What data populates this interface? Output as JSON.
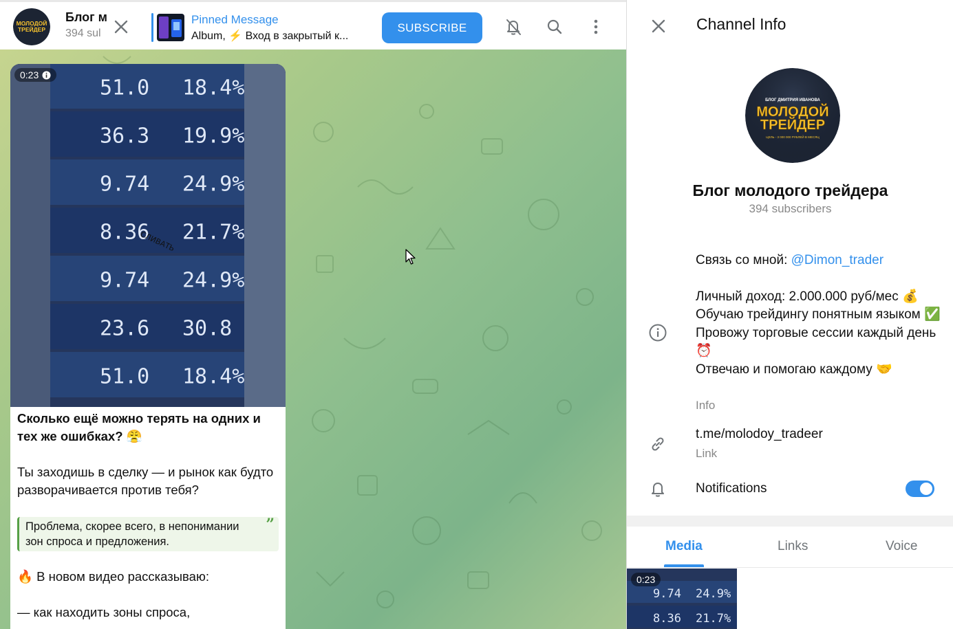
{
  "chat": {
    "header": {
      "title": "Блог м",
      "subscribers": "394 sul",
      "pinned_title": "Pinned Message",
      "pinned_body": "Album, ⚡ Вход в закрытый к...",
      "subscribe_label": "SUBSCRIBE"
    },
    "message": {
      "video_duration": "0:23",
      "video_rows": [
        {
          "left": "51.0",
          "right": "18.4%"
        },
        {
          "left": "36.3",
          "right": "19.9%"
        },
        {
          "left": "9.74",
          "right": "24.9%"
        },
        {
          "left": "8.36",
          "right": "21.7%"
        },
        {
          "left": "9.74",
          "right": "24.9%"
        },
        {
          "left": "23.6",
          "right": "30.8"
        },
        {
          "left": "51.0",
          "right": "18.4%"
        }
      ],
      "video_overlay_word": "СЛИВАТЬ",
      "heading": "Сколько ещё можно терять на одних и тех же ошибках? 😤",
      "paragraph1": "Ты заходишь в сделку — и рынок как будто разворачивается против тебя?",
      "quote": "Проблема, скорее всего, в непонимании зон спроса и предложения.",
      "paragraph2": "🔥 В новом видео рассказываю:",
      "paragraph3": "— как находить зоны спроса,"
    }
  },
  "panel": {
    "title": "Channel Info",
    "avatar": {
      "top_line": "БЛОГ ДМИТРИЯ ИВАНОВА",
      "word1": "МОЛОДОЙ",
      "word2": "ТРЕЙДЕР",
      "bottom_line": "ЦЕЛЬ - 3 000 000 РУБЛЕЙ В МЕСЯЦ"
    },
    "channel_name": "Блог молодого трейдера",
    "subscribers": "394 subscribers",
    "info": {
      "contact_prefix": "Связь со мной: ",
      "contact_handle": "@Dimon_trader",
      "line1": "Личный доход: 2.000.000 руб/мес 💰",
      "line2": "Обучаю трейдингу понятным языком ✅",
      "line3": "Провожу торговые сессии каждый день ⏰",
      "line4": "Отвечаю и помогаю каждому 🤝",
      "label": "Info"
    },
    "link": {
      "value": "t.me/molodoy_tradeer",
      "label": "Link"
    },
    "notifications": {
      "label": "Notifications",
      "enabled": true
    },
    "tabs": [
      "Media",
      "Links",
      "Voice"
    ],
    "active_tab": "Media",
    "media_duration": "0:23",
    "media_rows": [
      {
        "left": "9.74",
        "right": "24.9%"
      },
      {
        "left": "8.36",
        "right": "21.7%"
      }
    ]
  },
  "colors": {
    "accent": "#3390ec",
    "quote_border": "#56a046",
    "quote_bg": "#eef6e9"
  }
}
